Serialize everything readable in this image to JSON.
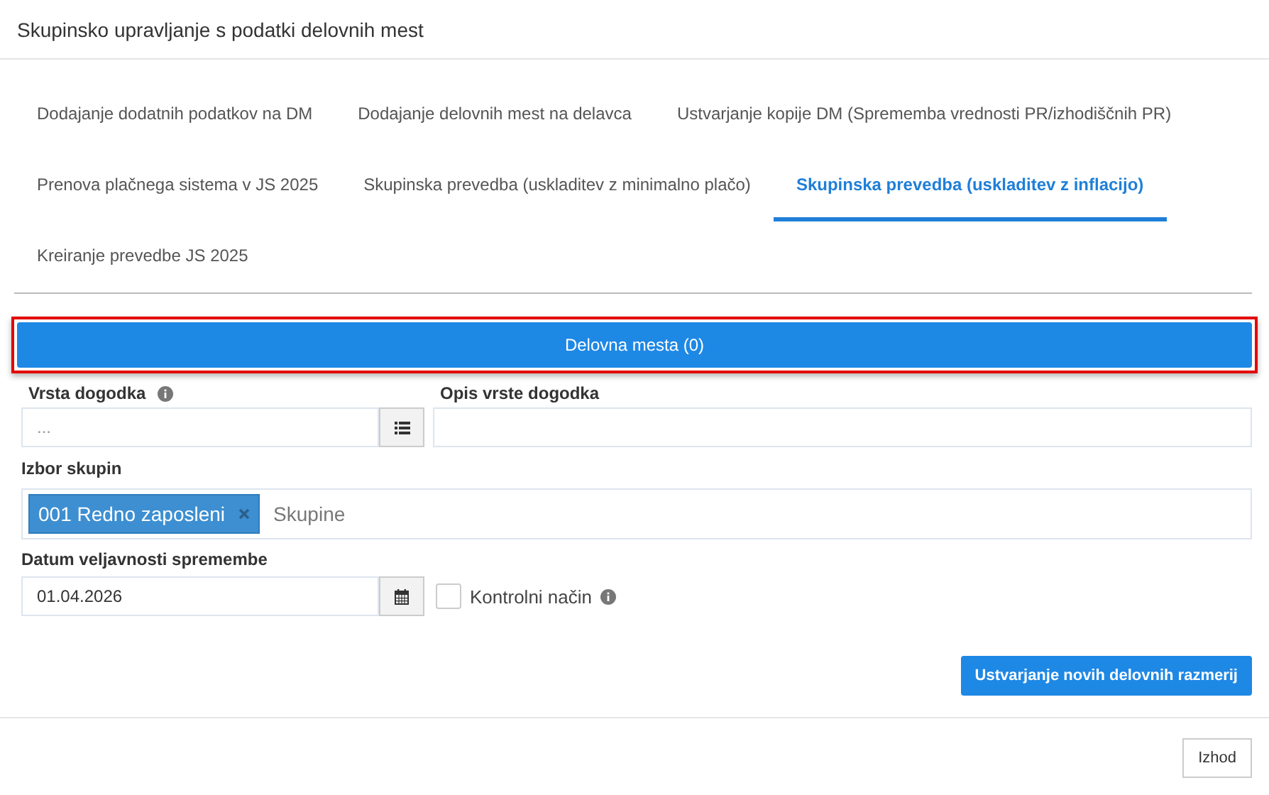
{
  "window": {
    "title": "Skupinsko upravljanje s podatki delovnih mest"
  },
  "tabs": [
    {
      "label": "Dodajanje dodatnih podatkov na DM",
      "selected": false
    },
    {
      "label": "Dodajanje delovnih mest na delavca",
      "selected": false
    },
    {
      "label": "Ustvarjanje kopije DM (Sprememba vrednosti PR/izhodiščnih PR)",
      "selected": false
    },
    {
      "label": "Prenova plačnega sistema v JS 2025",
      "selected": false
    },
    {
      "label": "Skupinska prevedba (uskladitev z minimalno plačo)",
      "selected": false
    },
    {
      "label": "Skupinska prevedba (uskladitev z inflacijo)",
      "selected": true
    },
    {
      "label": "Kreiranje prevedbe JS 2025",
      "selected": false
    }
  ],
  "section_button": {
    "label": "Delovna mesta (0)",
    "highlighted": true
  },
  "form": {
    "event_type": {
      "label": "Vrsta dogodka",
      "placeholder": "..."
    },
    "event_description": {
      "label": "Opis vrste dogodka"
    },
    "groups": {
      "label": "Izbor skupin",
      "tags": [
        "001 Redno zaposleni"
      ],
      "placeholder": "Skupine"
    },
    "date": {
      "label": "Datum veljavnosti spremembe",
      "value": "01.04.2026"
    },
    "control_mode": {
      "label": "Kontrolni način",
      "checked": false
    }
  },
  "action_button": "Ustvarjanje novih delovnih razmerij",
  "footer_button": "Izhod"
}
